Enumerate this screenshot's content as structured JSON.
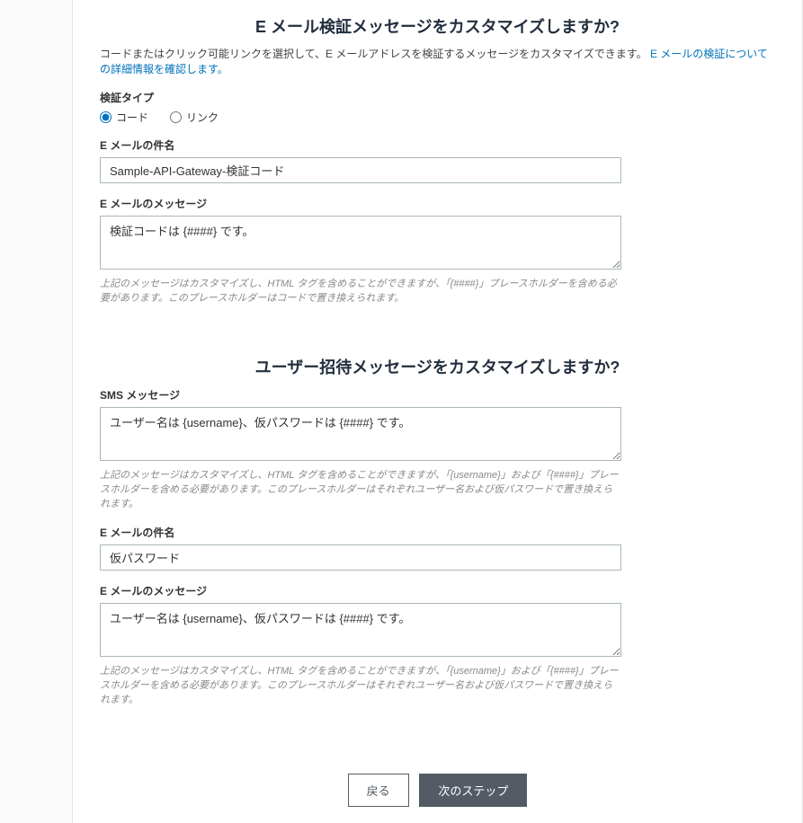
{
  "emailVerification": {
    "title": "E メール検証メッセージをカスタマイズしますか?",
    "description": "コードまたはクリック可能リンクを選択して、E メールアドレスを検証するメッセージをカスタマイズできます。",
    "linkText": "E メールの検証についての詳細情報を確認します。",
    "verificationTypeLabel": "検証タイプ",
    "radioCode": "コード",
    "radioLink": "リンク",
    "subjectLabel": "E メールの件名",
    "subjectValue": "Sample-API-Gateway-検証コード",
    "messageLabel": "E メールのメッセージ",
    "messageValue": "検証コードは {####} です。",
    "messageHelper": "上記のメッセージはカスタマイズし、HTML タグを含めることができますが、「{####}」プレースホルダーを含める必要があります。このプレースホルダーはコードで置き換えられます。"
  },
  "invitation": {
    "title": "ユーザー招待メッセージをカスタマイズしますか?",
    "smsLabel": "SMS メッセージ",
    "smsValue": "ユーザー名は {username}、仮パスワードは {####} です。",
    "smsHelper": "上記のメッセージはカスタマイズし、HTML タグを含めることができますが、「{username}」および「{####}」プレースホルダーを含める必要があります。このプレースホルダーはそれぞれユーザー名および仮パスワードで置き換えられます。",
    "subjectLabel": "E メールの件名",
    "subjectValue": "仮パスワード",
    "messageLabel": "E メールのメッセージ",
    "messageValue": "ユーザー名は {username}、仮パスワードは {####} です。",
    "messageHelper": "上記のメッセージはカスタマイズし、HTML タグを含めることができますが、「{username}」および「{####}」プレースホルダーを含める必要があります。このプレースホルダーはそれぞれユーザー名および仮パスワードで置き換えられます。"
  },
  "footer": {
    "back": "戻る",
    "next": "次のステップ"
  }
}
